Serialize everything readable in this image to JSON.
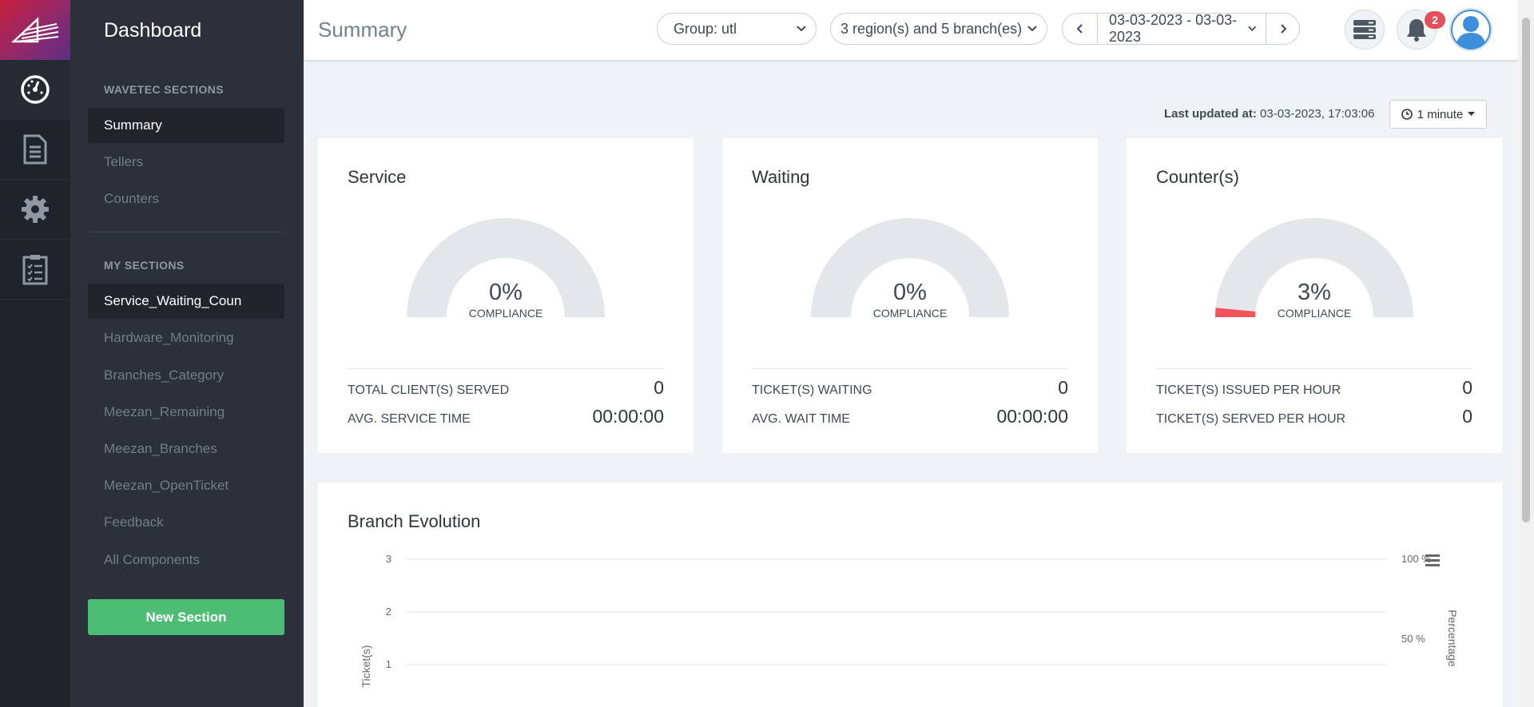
{
  "sidebar": {
    "title": "Dashboard",
    "wavetec_label": "WAVETEC SECTIONS",
    "wavetec_items": [
      "Summary",
      "Tellers",
      "Counters"
    ],
    "my_label": "MY SECTIONS",
    "my_items": [
      "Service_Waiting_Coun",
      "Hardware_Monitoring",
      "Branches_Category",
      "Meezan_Remaining",
      "Meezan_Branches",
      "Meezan_OpenTicket",
      "Feedback",
      "All Components"
    ],
    "new_section": "New Section"
  },
  "rail_icons": [
    "dashboard-icon",
    "document-icon",
    "settings-icon",
    "checklist-icon"
  ],
  "header": {
    "title": "Summary",
    "group": "Group: utl",
    "regions": "3 region(s) and 5 branch(es)",
    "date_range": "03-03-2023 - 03-03-2023",
    "notification_count": "2"
  },
  "status": {
    "last_updated_label": "Last updated at:",
    "last_updated_value": "03-03-2023, 17:03:06",
    "refresh": "1 minute"
  },
  "cards": [
    {
      "title": "Service",
      "percent": "0%",
      "compliance": "COMPLIANCE",
      "fill": 0,
      "rows": [
        {
          "label": "TOTAL CLIENT(S) SERVED",
          "value": "0"
        },
        {
          "label": "AVG. SERVICE TIME",
          "value": "00:00:00"
        }
      ]
    },
    {
      "title": "Waiting",
      "percent": "0%",
      "compliance": "COMPLIANCE",
      "fill": 0,
      "rows": [
        {
          "label": "TICKET(S) WAITING",
          "value": "0"
        },
        {
          "label": "AVG. WAIT TIME",
          "value": "00:00:00"
        }
      ]
    },
    {
      "title": "Counter(s)",
      "percent": "3%",
      "compliance": "COMPLIANCE",
      "fill": 0.03,
      "rows": [
        {
          "label": "TICKET(S) ISSUED PER HOUR",
          "value": "0"
        },
        {
          "label": "TICKET(S) SERVED PER HOUR",
          "value": "0"
        }
      ]
    }
  ],
  "colors": {
    "gauge_track": "#e4e7ea",
    "gauge_fill": "#f0525e",
    "accent_green": "#4dbd74",
    "sidebar_bg": "#2b303a"
  },
  "chart_data": {
    "type": "line",
    "title": "Branch Evolution",
    "ylabel": "Ticket(s)",
    "y2label": "Percentage",
    "y_ticks": [
      "3",
      "2",
      "1"
    ],
    "y2_ticks": [
      "100 %",
      "50 %"
    ],
    "ylim": [
      0,
      3
    ],
    "y2lim": [
      0,
      100
    ],
    "series": []
  }
}
